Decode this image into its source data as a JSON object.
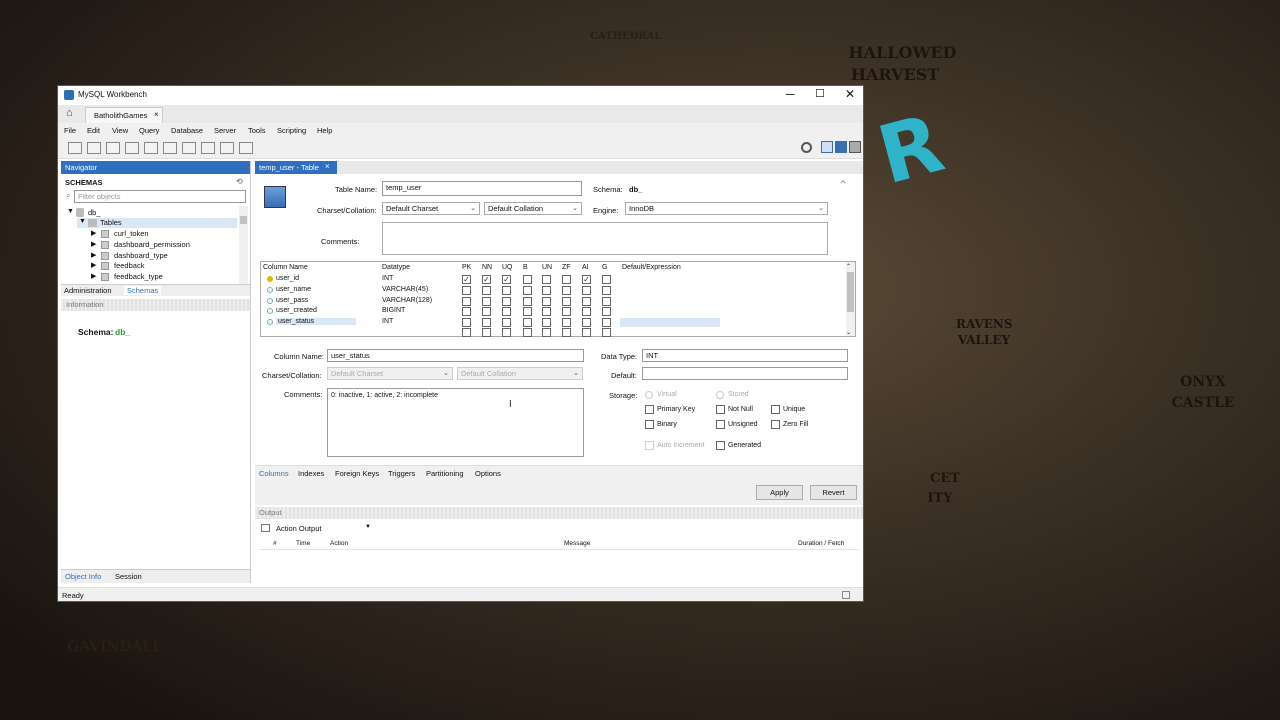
{
  "background": {
    "labels": [
      "CATHEDRAL",
      "HALLOWED",
      "HARVEST",
      "RAVENS",
      "VALLEY",
      "ONYX",
      "CASTLE",
      "GAVINDALE",
      "CET",
      "ITY"
    ],
    "logo_text": "R"
  },
  "window": {
    "title": "MySQL Workbench",
    "tab": "BatholithGames",
    "menu": [
      "File",
      "Edit",
      "View",
      "Query",
      "Database",
      "Server",
      "Tools",
      "Scripting",
      "Help"
    ]
  },
  "navigator": {
    "header": "Navigator",
    "schemas_title": "SCHEMAS",
    "filter_placeholder": "Filter objects",
    "schema": "db_",
    "tables_label": "Tables",
    "tables": [
      "curl_token",
      "dashboard_permission",
      "dashboard_type",
      "feedback",
      "feedback_type"
    ],
    "tabs": [
      "Administration",
      "Schemas"
    ],
    "info_header": "Information",
    "info_schema_label": "Schema:",
    "info_schema_value": "db_",
    "bottom_tabs": [
      "Object Info",
      "Session"
    ]
  },
  "editor": {
    "tab": "temp_user - Table",
    "table_name_label": "Table Name:",
    "table_name": "temp_user",
    "schema_label": "Schema:",
    "schema": "db_",
    "charset_label": "Charset/Collation:",
    "charset": "Default Charset",
    "collation": "Default Collation",
    "engine_label": "Engine:",
    "engine": "InnoDB",
    "comments_label": "Comments:",
    "columns_headers": [
      "Column Name",
      "Datatype",
      "PK",
      "NN",
      "UQ",
      "B",
      "UN",
      "ZF",
      "AI",
      "G",
      "Default/Expression"
    ],
    "rows": [
      {
        "name": "user_id",
        "type": "INT",
        "flags": [
          1,
          1,
          1,
          0,
          0,
          0,
          1,
          0
        ]
      },
      {
        "name": "user_name",
        "type": "VARCHAR(45)",
        "flags": [
          0,
          0,
          0,
          0,
          0,
          0,
          0,
          0
        ]
      },
      {
        "name": "user_pass",
        "type": "VARCHAR(128)",
        "flags": [
          0,
          0,
          0,
          0,
          0,
          0,
          0,
          0
        ]
      },
      {
        "name": "user_created",
        "type": "BIGINT",
        "flags": [
          0,
          0,
          0,
          0,
          0,
          0,
          0,
          0
        ]
      },
      {
        "name": "user_status",
        "type": "INT",
        "flags": [
          0,
          0,
          0,
          0,
          0,
          0,
          0,
          0
        ]
      }
    ],
    "detail": {
      "column_name_label": "Column Name:",
      "column_name": "user_status",
      "data_type_label": "Data Type:",
      "data_type": "INT",
      "charset_label": "Charset/Collation:",
      "charset": "Default Charset",
      "collation": "Default Collation",
      "default_label": "Default:",
      "default_value": "",
      "comments_label": "Comments:",
      "comments": "0: inactive, 1: active, 2: incomplete",
      "storage_label": "Storage:",
      "virtual": "Virtual",
      "stored": "Stored",
      "primary_key": "Primary Key",
      "not_null": "Not Null",
      "unique": "Unique",
      "binary": "Binary",
      "unsigned": "Unsigned",
      "zero_fill": "Zero Fill",
      "auto_increment": "Auto Increment",
      "generated": "Generated"
    },
    "sub_tabs": [
      "Columns",
      "Indexes",
      "Foreign Keys",
      "Triggers",
      "Partitioning",
      "Options"
    ],
    "apply": "Apply",
    "revert": "Revert"
  },
  "output": {
    "header": "Output",
    "mode": "Action Output",
    "columns": [
      "#",
      "Time",
      "Action",
      "Message",
      "Duration / Fetch"
    ]
  },
  "status": "Ready"
}
